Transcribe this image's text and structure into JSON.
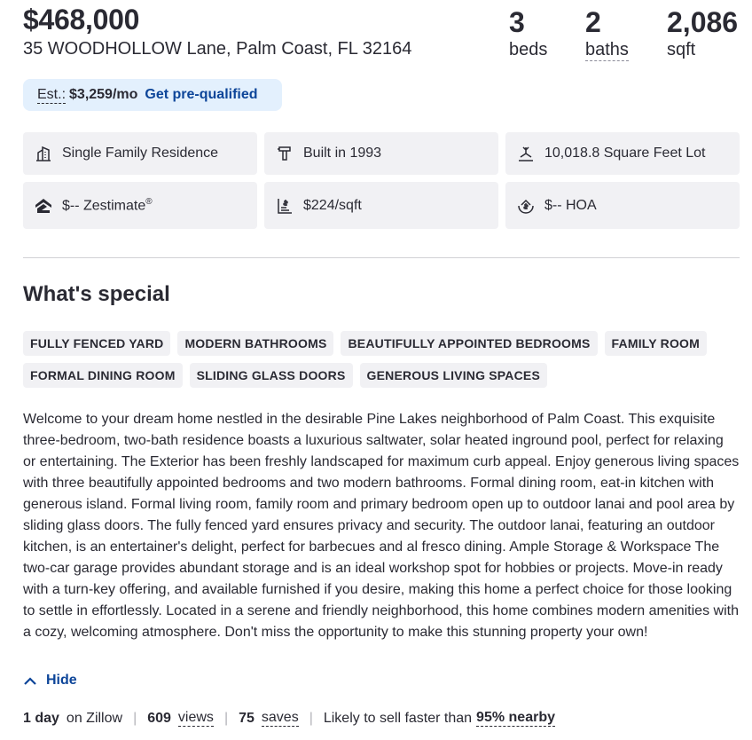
{
  "listing": {
    "price": "$468,000",
    "address": "35 WOODHOLLOW Lane, Palm Coast, FL 32164",
    "beds_value": "3",
    "beds_label": "beds",
    "baths_value": "2",
    "baths_label": "baths",
    "sqft_value": "2,086",
    "sqft_label": "sqft"
  },
  "estimate": {
    "label": "Est.:",
    "value": "$3,259/mo",
    "cta": "Get pre-qualified"
  },
  "facts": [
    {
      "icon": "building-icon",
      "text": "Single Family Residence"
    },
    {
      "icon": "hammer-icon",
      "text": "Built in 1993"
    },
    {
      "icon": "lot-size-icon",
      "text": "10,018.8 Square Feet Lot"
    },
    {
      "icon": "zestimate-icon",
      "text": "$-- Zestimate",
      "sup": "®"
    },
    {
      "icon": "price-per-sqft-icon",
      "text": "$224/sqft"
    },
    {
      "icon": "hoa-icon",
      "text": "$-- HOA"
    }
  ],
  "special": {
    "heading": "What's special",
    "tags": [
      "FULLY FENCED YARD",
      "MODERN BATHROOMS",
      "BEAUTIFULLY APPOINTED BEDROOMS",
      "FAMILY ROOM",
      "FORMAL DINING ROOM",
      "SLIDING GLASS DOORS",
      "GENEROUS LIVING SPACES"
    ],
    "description": "Welcome to your dream home nestled in the desirable Pine Lakes neighborhood of Palm Coast. This exquisite three-bedroom, two-bath residence boasts a luxurious saltwater, solar heated inground pool, perfect for relaxing or entertaining. The Exterior has been freshly landscaped for maximum curb appeal. Enjoy generous living spaces with three beautifully appointed bedrooms and two modern bathrooms. Formal dining room, eat-in kitchen with generous island. Formal living room, family room and primary bedroom open up to outdoor lanai and pool area by sliding glass doors. The fully fenced yard ensures privacy and security. The outdoor lanai, featuring an outdoor kitchen, is an entertainer's delight, perfect for barbecues and al fresco dining. Ample Storage & Workspace The two-car garage provides abundant storage and is an ideal workshop spot for hobbies or projects. Move-in ready with a turn-key offering, and available furnished if you desire, making this home a perfect choice for those looking to settle in effortlessly. Located in a serene and friendly neighborhood, this home combines modern amenities with a cozy, welcoming atmosphere. Don't miss the opportunity to make this stunning property your own!",
    "hide_label": "Hide"
  },
  "stats": {
    "days_value": "1 day",
    "days_suffix": "on Zillow",
    "views_value": "609",
    "views_label": "views",
    "saves_value": "75",
    "saves_label": "saves",
    "likely_text": "Likely to sell faster than",
    "likely_value": "95% nearby"
  },
  "colors": {
    "accent": "#0d4599",
    "estimate_bg": "#e3f0fd",
    "chip_bg": "#f1f1f4",
    "text": "#2a2a33"
  }
}
